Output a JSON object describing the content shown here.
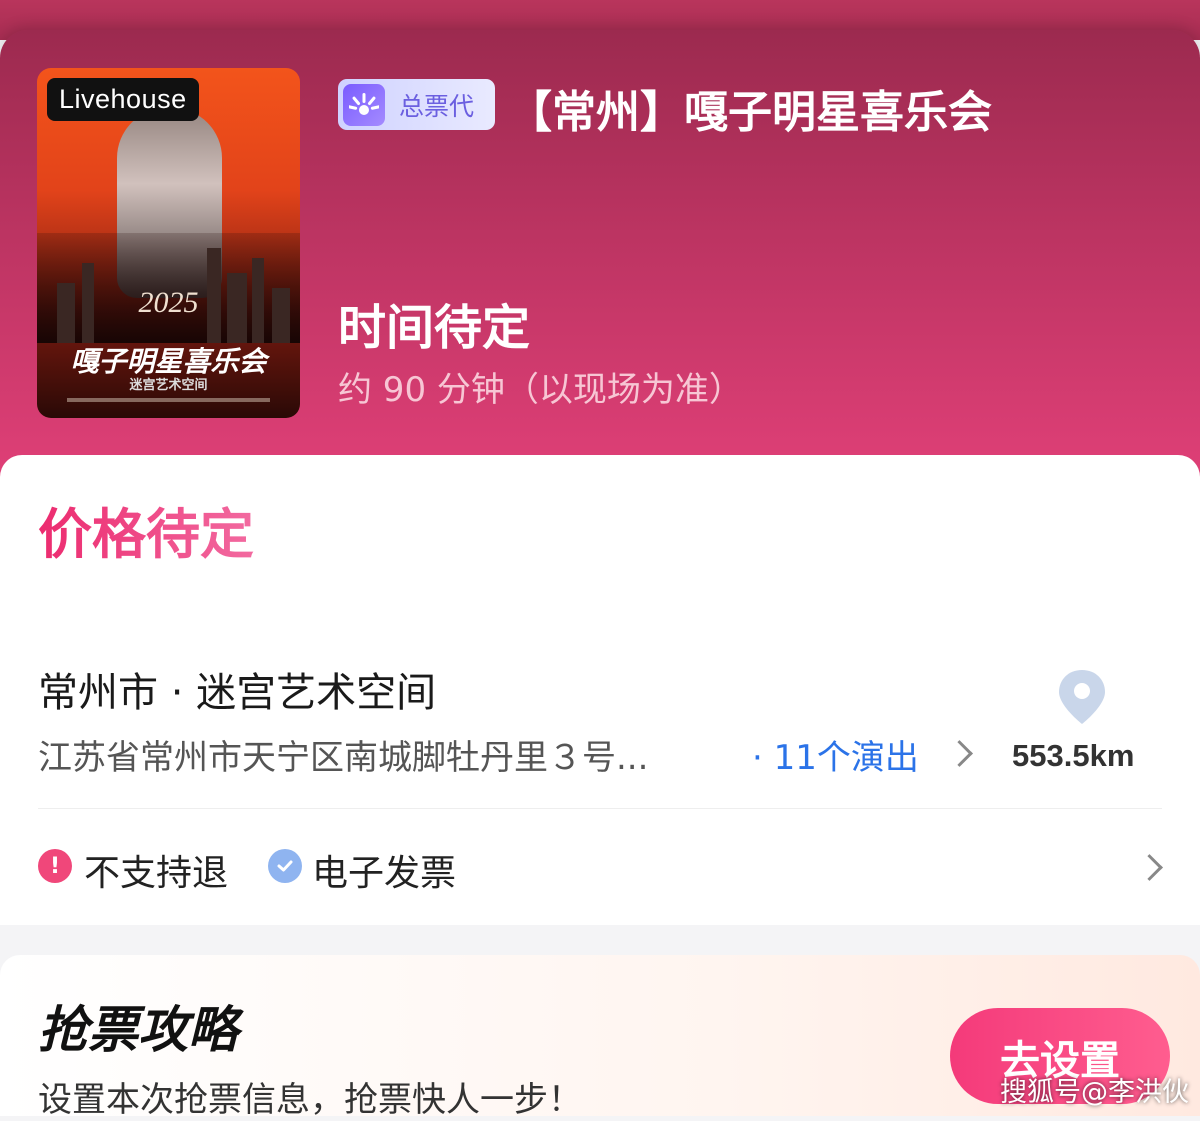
{
  "poster": {
    "badge": "Livehouse",
    "year": "2025",
    "title": "嘎子明星喜乐会",
    "subtitle": "迷宫艺术空间"
  },
  "event": {
    "agent_badge": "总票代",
    "title": "【常州】嘎子明星喜乐会",
    "time_status": "时间待定",
    "duration": "约 90 分钟（以现场为准）"
  },
  "price": {
    "status": "价格待定"
  },
  "venue": {
    "name": "常州市 · 迷宫艺术空间",
    "address": "江苏省常州市天宁区南城脚牡丹里３号...",
    "shows_link": "· 11个演出",
    "distance": "553.5km",
    "pin_icon": "map-pin-icon"
  },
  "policies": {
    "no_refund": "不支持退",
    "e_invoice": "电子发票"
  },
  "strategy": {
    "title": "抢票攻略",
    "subtitle": "设置本次抢票信息，抢票快人一步！",
    "button": "去设置"
  },
  "watermark": "搜狐号@李洪伙",
  "colors": {
    "hero_top": "#9c2a4f",
    "hero_bottom": "#e14078",
    "price_pink": "#ec2b6f",
    "link_blue": "#2b73e8",
    "button_pink": "#f43a7a"
  }
}
